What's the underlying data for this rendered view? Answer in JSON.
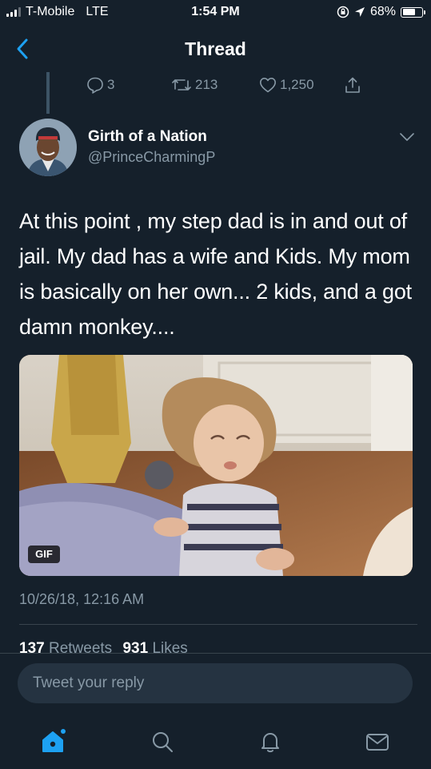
{
  "status_bar": {
    "carrier": "T-Mobile",
    "network": "LTE",
    "time": "1:54 PM",
    "battery": "68%",
    "battery_level": 0.68
  },
  "nav": {
    "title": "Thread",
    "back_icon": "chevron-left-icon"
  },
  "parent_tweet_actions": {
    "replies": "3",
    "retweets": "213",
    "likes": "1,250"
  },
  "tweet": {
    "author_name": "Girth of a Nation",
    "author_handle": "@PrinceCharmingP",
    "text": "At this point , my step dad is in and out of jail. My dad has a wife and Kids. My mom is basically on her own... 2 kids, and a got damn monkey....",
    "media_badge": "GIF",
    "timestamp": "10/26/18, 12:16 AM",
    "retweet_count": "137",
    "retweet_label": "Retweets",
    "like_count": "931",
    "like_label": "Likes"
  },
  "reply": {
    "placeholder": "Tweet your reply"
  },
  "tab_bar": {
    "tabs": [
      "home-icon",
      "search-icon",
      "notifications-icon",
      "messages-icon"
    ]
  },
  "colors": {
    "background": "#15202b",
    "accent": "#1da1f2",
    "secondary_text": "#8899a6",
    "input_background": "#253341"
  }
}
